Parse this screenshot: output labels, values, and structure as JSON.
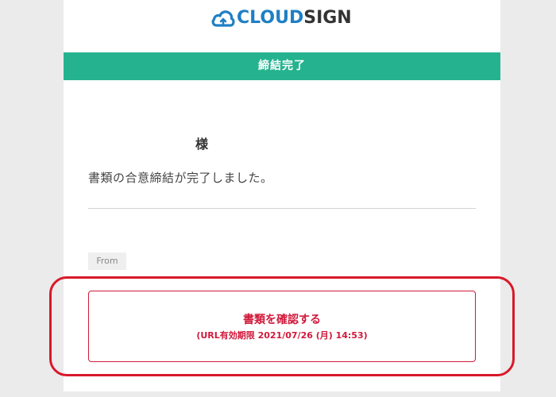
{
  "brand": {
    "logo_part1": "CLOUD",
    "logo_part2": "SIGN",
    "icon": "cloud-logo-icon"
  },
  "banner": {
    "title": "締結完了"
  },
  "email": {
    "recipient_honorific": "様",
    "message": "書類の合意締結が完了しました。",
    "from_label": "From"
  },
  "confirm_button": {
    "label": "書類を確認する",
    "expiry": "(URL有効期限 2021/07/26 (月) 14:53)"
  },
  "colors": {
    "brand_blue": "#1f7fc4",
    "banner_green": "#25b38f",
    "button_red": "#d0193b",
    "highlight_red": "#d8192a"
  }
}
